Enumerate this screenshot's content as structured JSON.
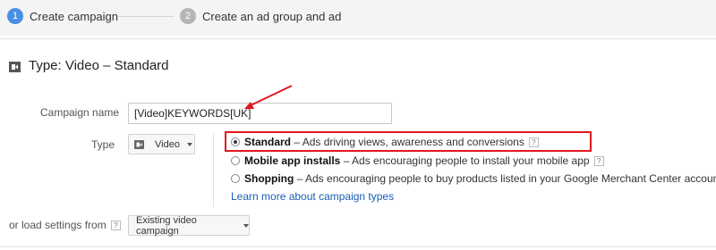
{
  "stepper": {
    "steps": [
      {
        "number": "1",
        "label": "Create campaign",
        "color": "#4a90e2"
      },
      {
        "number": "2",
        "label": "Create an ad group and ad",
        "color": "#b5b5b5"
      }
    ]
  },
  "section": {
    "title": "Type: Video – Standard",
    "icon": "video-camera-icon"
  },
  "campaign_name": {
    "label": "Campaign name",
    "value": "[Video]KEYWORDS[UK]"
  },
  "type_field": {
    "label": "Type",
    "dropdown_label": "Video",
    "options": [
      {
        "name": "Standard",
        "desc": " – Ads driving views, awareness and conversions",
        "selected": true,
        "help": "?"
      },
      {
        "name": "Mobile app installs",
        "desc": " – Ads encouraging people to install your mobile app",
        "selected": false,
        "help": "?"
      },
      {
        "name": "Shopping",
        "desc": " – Ads encouraging people to buy products listed in your Google Merchant Center account",
        "selected": false,
        "help": "?"
      }
    ],
    "learn_more": "Learn more about campaign types"
  },
  "load_settings": {
    "label": "or load settings from",
    "help": "?",
    "dropdown_label": "Existing video campaign"
  },
  "colors": {
    "annotation_red": "#e0191e",
    "link_blue": "#1a5fb4",
    "accent_blue": "#4a90e2"
  }
}
